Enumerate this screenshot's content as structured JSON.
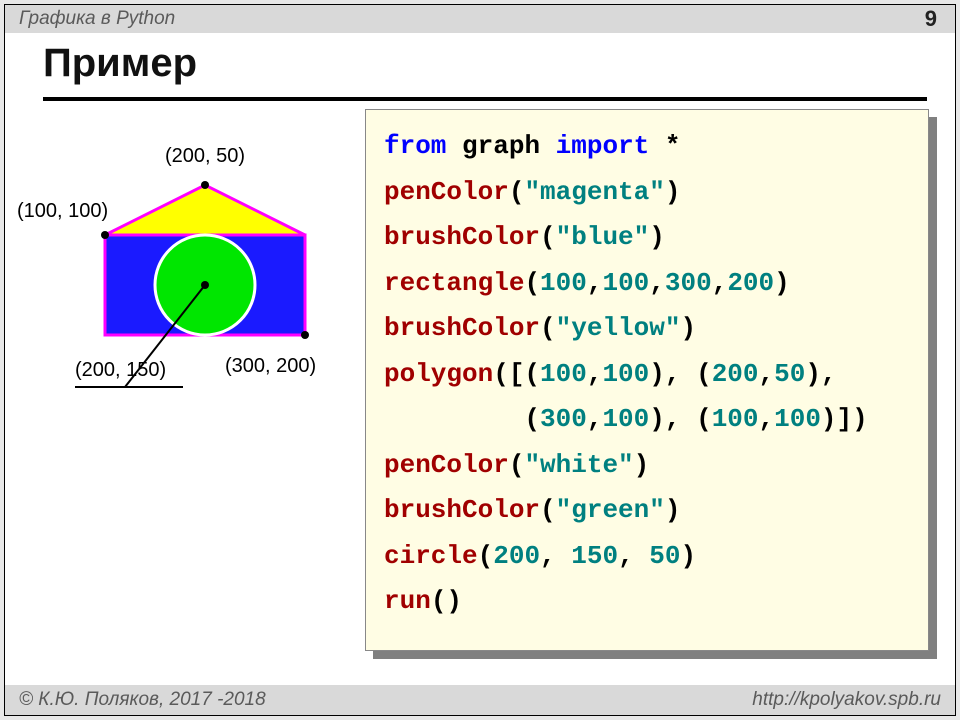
{
  "header": {
    "lecture_title": "Графика в Python",
    "page": "9"
  },
  "title": "Пример",
  "footer": {
    "copyright": "© К.Ю. Поляков, 2017 -2018",
    "url": "http://kpolyakov.spb.ru"
  },
  "labels": {
    "p200_50": "(200, 50)",
    "p100_100": "(100, 100)",
    "p300_200": "(300, 200)",
    "p200_150": "(200, 150)"
  },
  "code": {
    "l1_kw1": "from",
    "l1_id1": "graph",
    "l1_kw2": "import",
    "l1_star": "*",
    "l2_fn": "penColor",
    "l2_open": "(",
    "l2_str": "\"magenta\"",
    "l2_close": ")",
    "l3_fn": "brushColor",
    "l3_open": "(",
    "l3_str": "\"blue\"",
    "l3_close": ")",
    "l4_fn": "rectangle",
    "l4_open": "(",
    "l4_a": "100",
    "l4_c1": ",",
    "l4_b": "100",
    "l4_c2": ",",
    "l4_c": "300",
    "l4_c3": ",",
    "l4_d": "200",
    "l4_close": ")",
    "l5_fn": "brushColor",
    "l5_open": "(",
    "l5_str": "\"yellow\"",
    "l5_close": ")",
    "l6_fn": "polygon",
    "l6_open": "([(",
    "l6_a": "100",
    "l6_c1": ",",
    "l6_b": "100",
    "l6_mid": "), (",
    "l6_c": "200",
    "l6_c2": ",",
    "l6_d": "50",
    "l6_close": "),",
    "l7_pad": "         (",
    "l7_a": "300",
    "l7_c1": ",",
    "l7_b": "100",
    "l7_mid": "), (",
    "l7_c": "100",
    "l7_c2": ",",
    "l7_d": "100",
    "l7_close": ")])",
    "l8_fn": "penColor",
    "l8_open": "(",
    "l8_str": "\"white\"",
    "l8_close": ")",
    "l9_fn": "brushColor",
    "l9_open": "(",
    "l9_str": "\"green\"",
    "l9_close": ")",
    "l10_fn": "circle",
    "l10_open": "(",
    "l10_a": "200",
    "l10_c1": ", ",
    "l10_b": "150",
    "l10_c2": ", ",
    "l10_c": "50",
    "l10_close": ")",
    "l11_fn": "run",
    "l11_rest": "()"
  }
}
